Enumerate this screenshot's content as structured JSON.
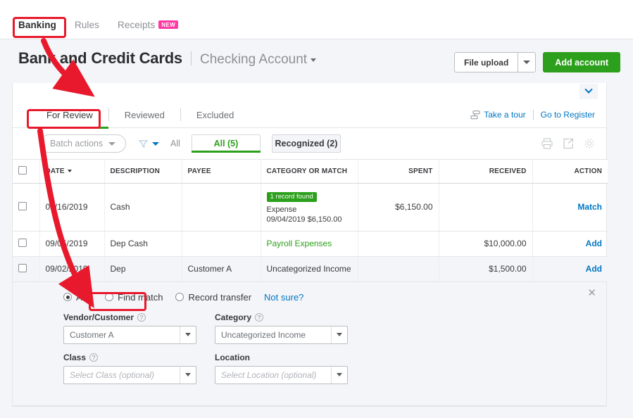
{
  "topnav": {
    "items": [
      {
        "label": "Banking",
        "active": true,
        "badge": null
      },
      {
        "label": "Rules",
        "active": false,
        "badge": null
      },
      {
        "label": "Receipts",
        "active": false,
        "badge": "NEW"
      }
    ]
  },
  "header": {
    "title": "Bank and Credit Cards",
    "account": "Checking Account",
    "file_upload_label": "File upload",
    "add_account_label": "Add account"
  },
  "subtabs": {
    "items": [
      {
        "label": "For Review",
        "active": true
      },
      {
        "label": "Reviewed",
        "active": false
      },
      {
        "label": "Excluded",
        "active": false
      }
    ],
    "take_a_tour": "Take a tour",
    "go_to_register": "Go to Register"
  },
  "toolbar": {
    "batch_actions": "Batch actions",
    "all_filter": "All",
    "filters": [
      {
        "label": "All (5)",
        "selected": true
      },
      {
        "label": "Recognized (2)",
        "selected": false
      }
    ],
    "icons": [
      "print-icon",
      "export-icon",
      "gear-icon"
    ]
  },
  "table": {
    "columns": [
      "DATE",
      "DESCRIPTION",
      "PAYEE",
      "CATEGORY OR MATCH",
      "SPENT",
      "RECEIVED",
      "ACTION"
    ],
    "rows": [
      {
        "date": "09/16/2019",
        "description": "Cash",
        "payee": "",
        "match_chip": "1 record found",
        "category": "Expense",
        "category_detail": "09/04/2019 $6,150.00",
        "spent": "$6,150.00",
        "received": "",
        "action": "Match",
        "selected": false
      },
      {
        "date": "09/05/2019",
        "description": "Dep Cash",
        "payee": "",
        "match_chip": null,
        "category": "Payroll Expenses",
        "category_detail": "",
        "spent": "",
        "received": "$10,000.00",
        "action": "Add",
        "selected": false
      },
      {
        "date": "09/02/2019",
        "description": "Dep",
        "payee": "Customer A",
        "match_chip": null,
        "category": "Uncategorized Income",
        "category_detail": "",
        "spent": "",
        "received": "$1,500.00",
        "action": "Add",
        "selected": true
      }
    ]
  },
  "expand_panel": {
    "close_label": "✕",
    "radios": [
      {
        "label": "Add",
        "selected": true
      },
      {
        "label": "Find match",
        "selected": false
      },
      {
        "label": "Record transfer",
        "selected": false
      }
    ],
    "not_sure": "Not sure?",
    "fields": [
      {
        "label": "Vendor/Customer",
        "has_help": true,
        "value": "Customer A",
        "placeholder": "",
        "is_placeholder": false
      },
      {
        "label": "Category",
        "has_help": true,
        "value": "Uncategorized Income",
        "placeholder": "",
        "is_placeholder": false
      },
      {
        "label": "Class",
        "has_help": true,
        "value": "",
        "placeholder": "Select Class (optional)",
        "is_placeholder": true
      },
      {
        "label": "Location",
        "has_help": false,
        "value": "",
        "placeholder": "Select Location (optional)",
        "is_placeholder": true
      }
    ]
  },
  "annotations": {
    "color": "#e8192c",
    "boxes": [
      "banking-tab",
      "for-review-tab",
      "find-match-radio"
    ],
    "arrows": [
      "banking-to-for-review",
      "for-review-to-find-match"
    ]
  }
}
